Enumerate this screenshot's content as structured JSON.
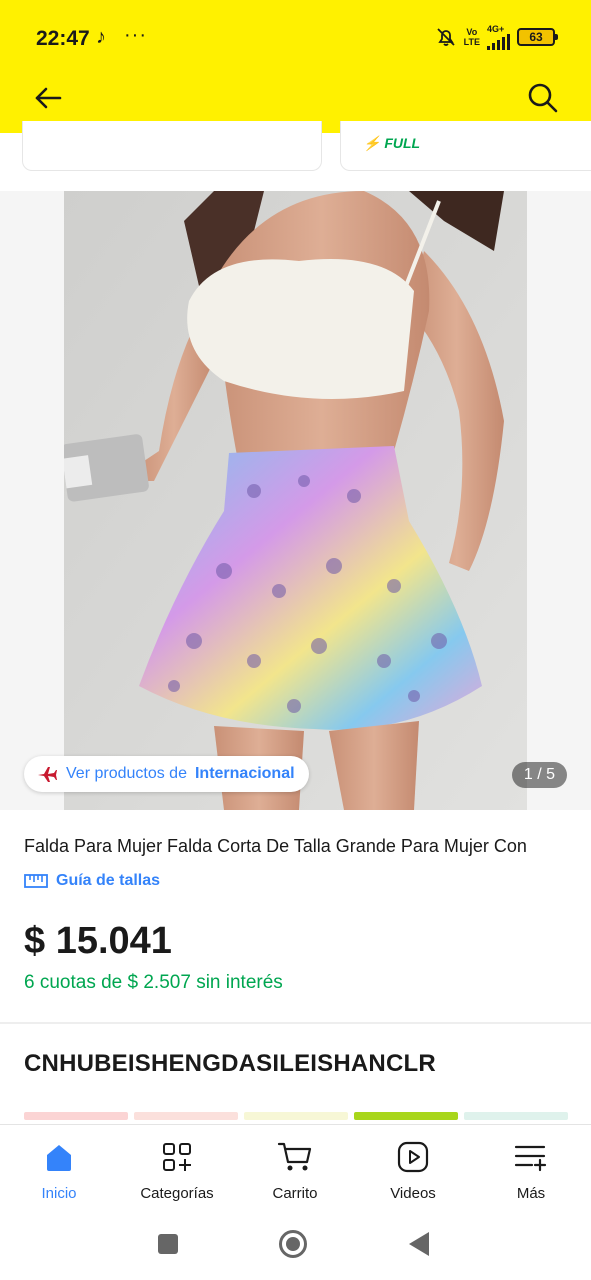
{
  "status_bar": {
    "time": "22:47",
    "extra": "···",
    "volte_top": "Vo",
    "volte_bottom": "LTE",
    "network": "4G+",
    "battery": "63"
  },
  "header": {
    "bg_color": "#fff100",
    "back_icon": "arrow-left-icon",
    "search_icon": "search-icon"
  },
  "shipping": {
    "full_label": "FULL"
  },
  "gallery": {
    "chip_prefix": "Ver productos de",
    "chip_store": "Internacional",
    "counter": "1 / 5"
  },
  "product": {
    "title": "Falda Para Mujer Falda Corta De Talla Grande Para Mujer Con",
    "size_guide": "Guía de tallas",
    "price": "$ 15.041",
    "installments": "6 cuotas de $ 2.507 sin interés",
    "seller": "CNHUBEISHENGDASILEISHANCLR"
  },
  "colors": {
    "brand_yellow": "#fff100",
    "accent_blue": "#3483fa",
    "green": "#00a650",
    "swatches": [
      "#fbd4d4",
      "#fbe0dc",
      "#f7f7d6",
      "#a8d61b",
      "#dff2ec"
    ]
  },
  "bottom_nav": {
    "items": [
      {
        "label": "Inicio",
        "icon": "home-icon"
      },
      {
        "label": "Categorías",
        "icon": "categories-icon"
      },
      {
        "label": "Carrito",
        "icon": "cart-icon"
      },
      {
        "label": "Videos",
        "icon": "play-icon"
      },
      {
        "label": "Más",
        "icon": "menu-plus-icon"
      }
    ]
  }
}
